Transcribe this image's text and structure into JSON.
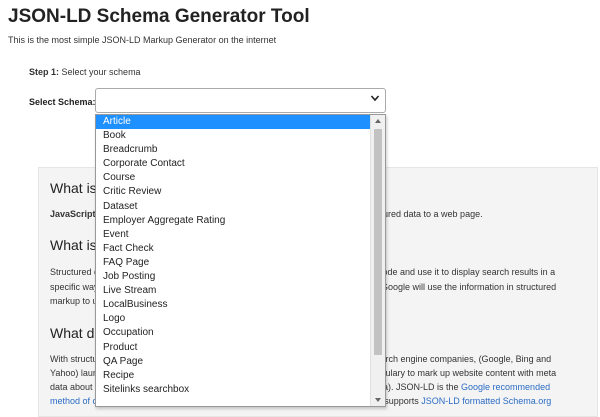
{
  "header": {
    "title": "JSON-LD Schema Generator Tool",
    "subtitle": "This is the most simple JSON-LD Markup Generator on the internet"
  },
  "step": {
    "label": "Step 1:",
    "text": "Select your schema"
  },
  "schema": {
    "label": "Select Schema:",
    "selected_index": 0,
    "options": [
      "Article",
      "Book",
      "Breadcrumb",
      "Corporate Contact",
      "Course",
      "Critic Review",
      "Dataset",
      "Employer Aggregate Rating",
      "Event",
      "Fact Check",
      "FAQ Page",
      "Job Posting",
      "Live Stream",
      "LocalBusiness",
      "Logo",
      "Occupation",
      "Product",
      "QA Page",
      "Recipe",
      "Sitelinks searchbox"
    ]
  },
  "content": {
    "heading1": "What is",
    "p1_start": "JavaScript O",
    "p1_end": "uctured data to a web page.",
    "heading2": "What is",
    "p2_line1_start": "Structured d",
    "p2_line1_end": "s code and use it to display search results in a",
    "p2_line2_start": "specific way",
    "p2_line2_end": "e. Google will use the information in structured",
    "p2_line3_start": "markup to u",
    "heading3": "What d",
    "p3_line1_start": "With structu",
    "p3_line1_end": "search engine companies, (Google, Bing and",
    "p3_line2_start": "Yahoo) laun",
    "p3_line2_end": "cabulary to mark up website content with meta",
    "p3_line3_start": "data about",
    "p3_line3_mid": "DFa). JSON-LD is the ",
    "p3_line3_link": "Google recommended",
    "p3_line4_link": "method of creating structured data",
    "p3_line4_mid": ". Bing announced in March 2018, that it now also supports ",
    "p3_line4_link2": "JSON-LD formatted Schema.org"
  },
  "colors": {
    "selected_bg": "#1e90ff",
    "link": "#2b6cc4",
    "box_bg": "#f4f4f4"
  }
}
